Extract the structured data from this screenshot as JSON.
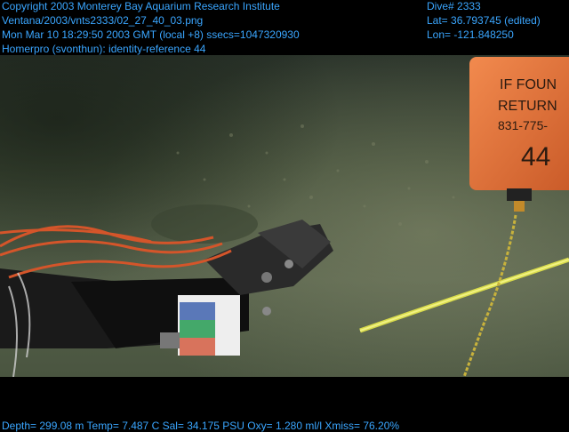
{
  "header": {
    "copyright": "Copyright 2003 Monterey Bay Aquarium Research Institute",
    "file_path": "Ventana/2003/vnts2333/02_27_40_03.png",
    "timestamp": "Mon Mar 10 18:29:50 2003 GMT (local +8)  ssecs=1047320930",
    "annotation": "Homerpro (svonthun): identity-reference 44",
    "dive": "Dive# 2333",
    "lat": "Lat= 36.793745 (edited)",
    "lon": "Lon= -121.848250"
  },
  "footer": {
    "telemetry": "Depth= 299.08 m  Temp= 7.487 C  Sal= 34.175 PSU  Oxy= 1.280 ml/l  Xmiss= 76.20%"
  },
  "marker_tag": {
    "lines": [
      "IF FOUN",
      "RETURN",
      "831-775-",
      "44"
    ]
  },
  "colors": {
    "overlay_text": "#3aa6ff",
    "seafloor": "#4c5a3e",
    "tag_orange": "#e8763e",
    "cable_yellow": "#e6e84a"
  }
}
